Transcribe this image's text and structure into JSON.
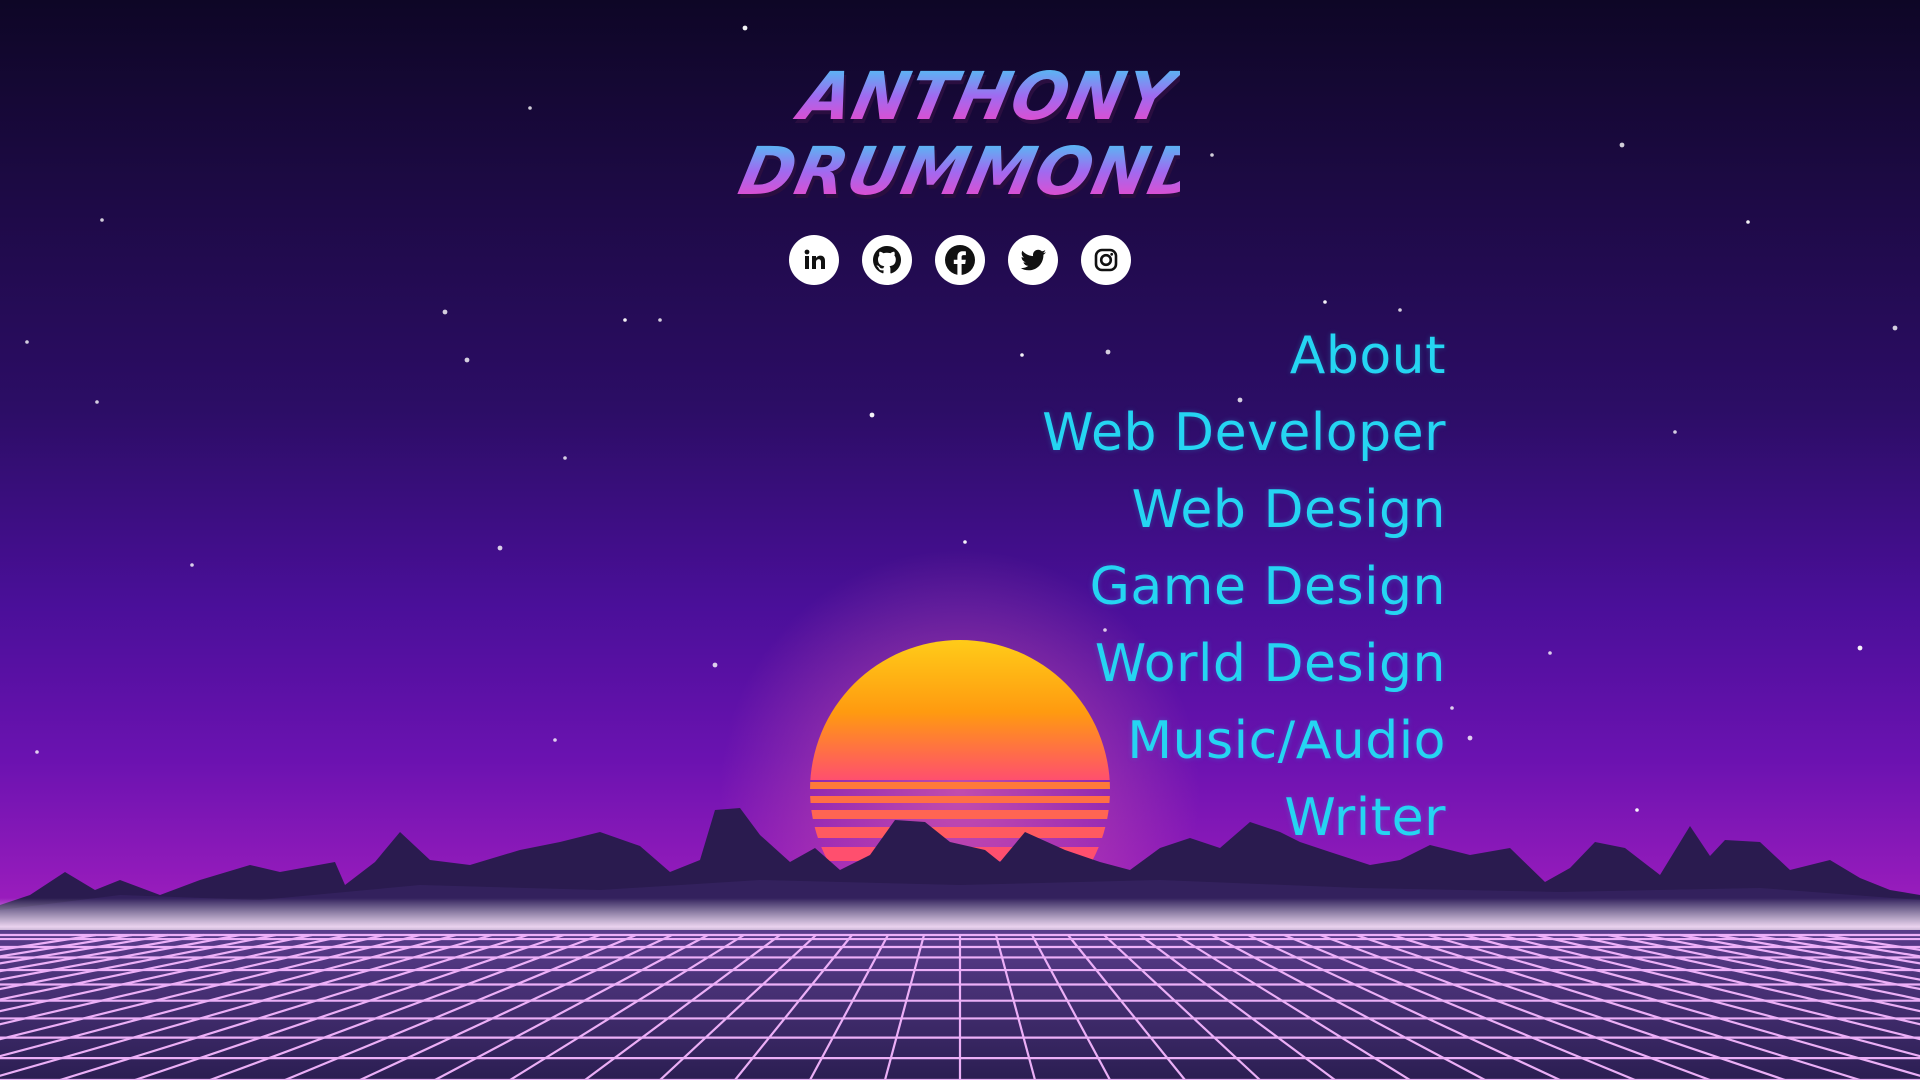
{
  "site": {
    "logo_line1": "ANTHONY",
    "logo_line2": "DRUMMOND"
  },
  "socials": [
    {
      "name": "LinkedIn",
      "icon": "linkedin-icon"
    },
    {
      "name": "GitHub",
      "icon": "github-icon"
    },
    {
      "name": "Facebook",
      "icon": "facebook-icon"
    },
    {
      "name": "Twitter",
      "icon": "twitter-icon"
    },
    {
      "name": "Instagram",
      "icon": "instagram-icon"
    }
  ],
  "nav": {
    "items": [
      {
        "label": "About"
      },
      {
        "label": "Web Developer"
      },
      {
        "label": "Web Design"
      },
      {
        "label": "Game Design"
      },
      {
        "label": "World Design"
      },
      {
        "label": "Music/Audio"
      },
      {
        "label": "Writer"
      }
    ]
  },
  "colors": {
    "nav_text": "#25d5f2",
    "logo_gradient_top": "#3ad8f5",
    "logo_gradient_bottom": "#ff3fc0",
    "sun_top": "#ffd21a",
    "sun_bottom": "#ff4f6e",
    "grid_lines": "#f6b7ff"
  }
}
